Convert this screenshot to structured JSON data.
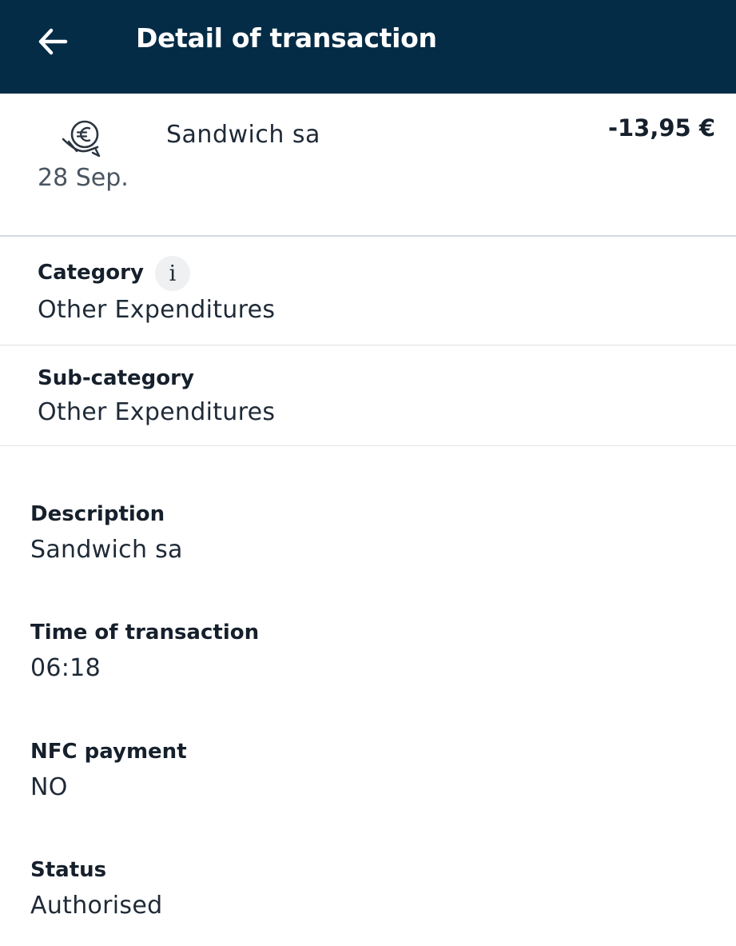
{
  "header": {
    "title": "Detail of transaction",
    "back_icon": "arrow-left-icon"
  },
  "transaction": {
    "icon": "euro-hand-icon",
    "date": "28 Sep.",
    "merchant": "Sandwich sa",
    "amount": "-13,95 €"
  },
  "category": {
    "label": "Category",
    "value": "Other Expenditures",
    "info_icon": "info-icon"
  },
  "subcategory": {
    "label": "Sub-category",
    "value": "Other Expenditures"
  },
  "details": [
    {
      "label": "Description",
      "value": "Sandwich sa"
    },
    {
      "label": "Time of transaction",
      "value": "06:18"
    },
    {
      "label": "NFC payment",
      "value": "NO"
    },
    {
      "label": "Status",
      "value": "Authorised"
    }
  ],
  "colors": {
    "header_bg": "#042c46",
    "header_text": "#ffffff",
    "text_primary": "#16202c",
    "text_secondary": "#4a5560",
    "divider": "#d4d8dc"
  }
}
